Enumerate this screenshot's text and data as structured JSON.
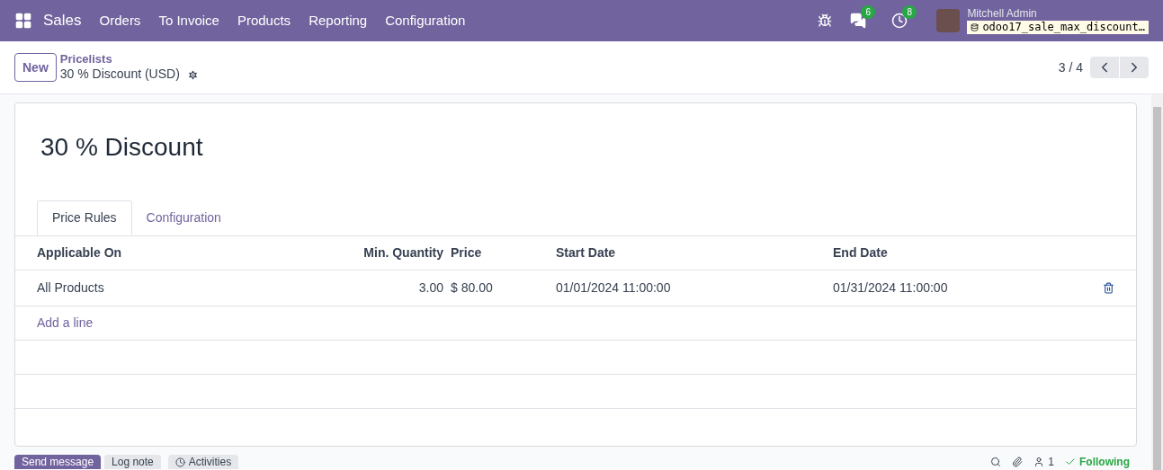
{
  "navbar": {
    "app": "Sales",
    "menu": [
      "Orders",
      "To Invoice",
      "Products",
      "Reporting",
      "Configuration"
    ],
    "messages_count": "6",
    "activities_count": "8",
    "user": "Mitchell Admin",
    "database": "odoo17_sale_max_discount…"
  },
  "control_panel": {
    "new_button": "New",
    "breadcrumb": "Pricelists",
    "record": "30 % Discount (USD)",
    "pager": "3 / 4"
  },
  "form": {
    "title": "30 % Discount",
    "tabs": [
      {
        "label": "Price Rules",
        "selected": true
      },
      {
        "label": "Configuration",
        "selected": false
      }
    ],
    "table": {
      "columns": [
        "Applicable On",
        "Min. Quantity",
        "Price",
        "Start Date",
        "End Date"
      ],
      "rows": [
        {
          "applicable_on": "All Products",
          "min_quantity": "3.00",
          "price": "$ 80.00",
          "start_date": "01/01/2024 11:00:00",
          "end_date": "01/31/2024 11:00:00"
        }
      ],
      "add_line": "Add a line"
    }
  },
  "chatter": {
    "send_message": "Send message",
    "log_note": "Log note",
    "activities": "Activities",
    "followers_count": "1",
    "following": "Following"
  }
}
